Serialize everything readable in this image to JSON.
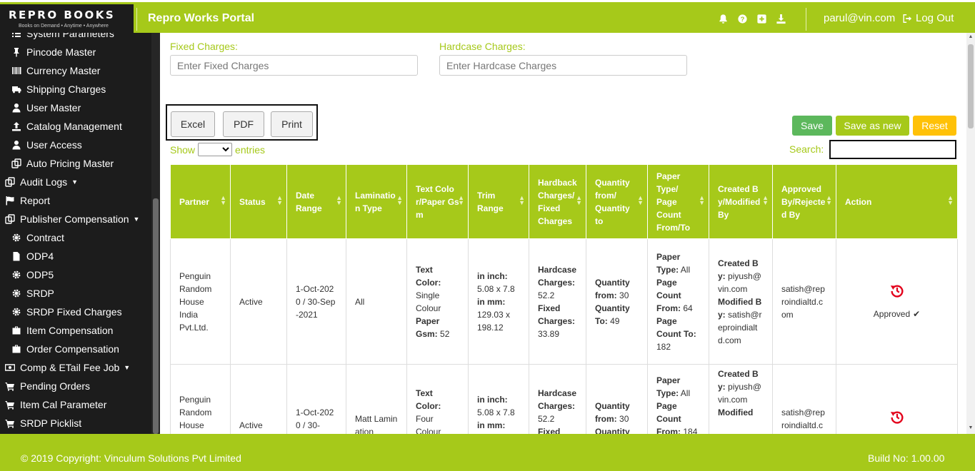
{
  "header": {
    "logo_title": "REPRO BOOKS",
    "logo_tagline": "Books on Demand • Anytime • Anywhere",
    "portal_title": "Repro Works Portal",
    "user_email": "parul@vin.com",
    "logout_label": "Log Out",
    "icons": [
      "bell-icon",
      "help-icon",
      "plus-square-icon",
      "download-icon"
    ]
  },
  "sidebar": {
    "items": [
      {
        "label": "System Parameters",
        "icon": "list-icon"
      },
      {
        "label": "Pincode Master",
        "icon": "pin-icon"
      },
      {
        "label": "Currency Master",
        "icon": "barcode-icon"
      },
      {
        "label": "Shipping Charges",
        "icon": "truck-icon"
      },
      {
        "label": "User Master",
        "icon": "user-icon"
      },
      {
        "label": "Catalog Management",
        "icon": "upload-icon"
      },
      {
        "label": "User Access",
        "icon": "user-icon"
      },
      {
        "label": "Auto Pricing Master",
        "icon": "clone-icon"
      },
      {
        "label": "Audit Logs",
        "icon": "clone-icon"
      },
      {
        "label": "Report",
        "icon": "flag-icon"
      },
      {
        "label": "Publisher Compensation",
        "icon": "clone-icon"
      },
      {
        "label": "Contract",
        "icon": "cog-icon"
      },
      {
        "label": "ODP4",
        "icon": "file-icon"
      },
      {
        "label": "ODP5",
        "icon": "cog-icon"
      },
      {
        "label": "SRDP",
        "icon": "cog-icon"
      },
      {
        "label": "SRDP Fixed Charges",
        "icon": "cog-icon"
      },
      {
        "label": "Item Compensation",
        "icon": "briefcase-icon"
      },
      {
        "label": "Order Compensation",
        "icon": "briefcase-icon"
      },
      {
        "label": "Comp & ETail Fee Job",
        "icon": "money-icon"
      },
      {
        "label": "Pending Orders",
        "icon": "cart-icon"
      },
      {
        "label": "Item Cal Parameter",
        "icon": "cart-icon"
      },
      {
        "label": "SRDP Picklist",
        "icon": "cart-icon"
      }
    ]
  },
  "form": {
    "fixed_charges_label": "Fixed Charges:",
    "fixed_charges_placeholder": "Enter Fixed Charges",
    "hardcase_charges_label": "Hardcase Charges:",
    "hardcase_charges_placeholder": "Enter Hardcase Charges"
  },
  "actions": {
    "save": "Save",
    "save_as_new": "Save as new",
    "reset": "Reset"
  },
  "export": {
    "excel": "Excel",
    "pdf": "PDF",
    "print": "Print"
  },
  "table_controls": {
    "show_label": "Show",
    "entries_label": "entries",
    "search_label": "Search:"
  },
  "table": {
    "columns": [
      "Partner",
      "Status",
      "Date Range",
      "Lamination Type",
      "Text Color/Paper Gsm",
      "Trim Range",
      "Hardback Charges/ Fixed Charges",
      "Quantity from/ Quantity to",
      "Paper Type/ Page Count From/To",
      "Created By/Modified By",
      "Approved By/Rejected By",
      "Action"
    ],
    "rows": [
      {
        "partner": "Penguin Random House India Pvt.Ltd.",
        "status": "Active",
        "date_range": "1-Oct-2020 / 30-Sep-2021",
        "lamination": "All",
        "text_color_label": "Text Color:",
        "text_color": "Single Colour",
        "paper_gsm_label": "Paper Gsm:",
        "paper_gsm": "52",
        "inch_label": "in inch:",
        "inch": "5.08 x 7.8",
        "mm_label": "in mm:",
        "mm": "129.03 x 198.12",
        "hardcase_label": "Hardcase Charges:",
        "hardcase": "52.2",
        "fixed_label": "Fixed Charges:",
        "fixed": "33.89",
        "qty_from_label": "Quantity from:",
        "qty_from": "30",
        "qty_to_label": "Quantity To:",
        "qty_to": "49",
        "paper_type_label": "Paper Type:",
        "paper_type": "All",
        "page_from_label": "Page Count From:",
        "page_from": "64",
        "page_to_label": "Page Count To:",
        "page_to": "182",
        "created_label": "Created By:",
        "created_by": "piyush@vin.com",
        "modified_label": "Modified By:",
        "modified_by": "satish@reproindialtd.com",
        "approved_by": "satish@reproindialtd.com",
        "action_status": "Approved"
      },
      {
        "partner": "Penguin Random House",
        "status": "Active",
        "date_range": "1-Oct-2020 / 30-",
        "lamination": "Matt Lamination",
        "text_color_label": "Text Color:",
        "text_color": "Four Colour",
        "inch_label": "in inch:",
        "inch": "5.08 x 7.8",
        "mm_label": "in mm:",
        "hardcase_label": "Hardcase Charges:",
        "hardcase": "52.2",
        "fixed_label": "Fixed",
        "qty_from_label": "Quantity from:",
        "qty_from": "30",
        "qty_to_label": "Quantity",
        "paper_type_label": "Paper Type:",
        "paper_type": "All",
        "page_from_label": "Page Count From:",
        "page_from": "184",
        "created_label": "Created By:",
        "created_by": "piyush@vin.com",
        "modified_label": "Modified",
        "approved_by": "satish@reproindialtd.c"
      }
    ]
  },
  "footer": {
    "copyright": "© 2019 Copyright: Vinculum Solutions Pvt Limited",
    "build": "Build No: 1.00.00"
  },
  "colors": {
    "brand": "#a6c91a",
    "sidebar_bg": "#1c1c1c",
    "save": "#5cb85c",
    "reset": "#ffc107",
    "restore_icon": "#e3001b"
  }
}
